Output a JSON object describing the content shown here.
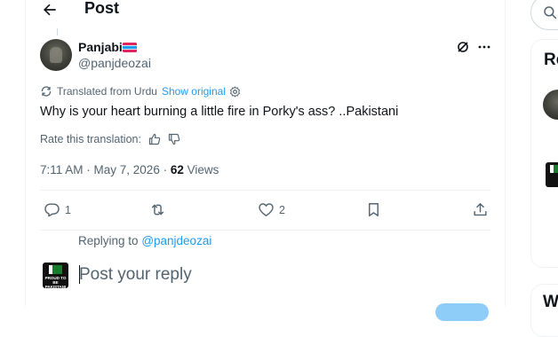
{
  "header": {
    "title": "Post"
  },
  "post": {
    "author": {
      "display_name": "Panjabi",
      "handle": "@panjdeozai"
    },
    "translation": {
      "label": "Translated from Urdu",
      "show_original": "Show original"
    },
    "text": "Why is your heart burning a little fire in Porky's ass? ..Pakistani",
    "rate_label": "Rate this translation:",
    "time": "7:11 AM · May 7, 2026",
    "view_count": "62",
    "views_label": "Views"
  },
  "actions": {
    "replies": "1",
    "likes": "2"
  },
  "reply": {
    "replying_to_label": "Replying to",
    "replying_to_handle": "@panjdeozai",
    "placeholder": "Post your reply",
    "avatar_text": "PROUD TO BE PAKISTANI"
  },
  "sidebar": {
    "section_title_1": "Re",
    "section_title_2": "W"
  },
  "colors": {
    "accent": "#1d9bf0",
    "text": "#0f1419",
    "muted": "#536471",
    "border": "#eff3f4"
  }
}
